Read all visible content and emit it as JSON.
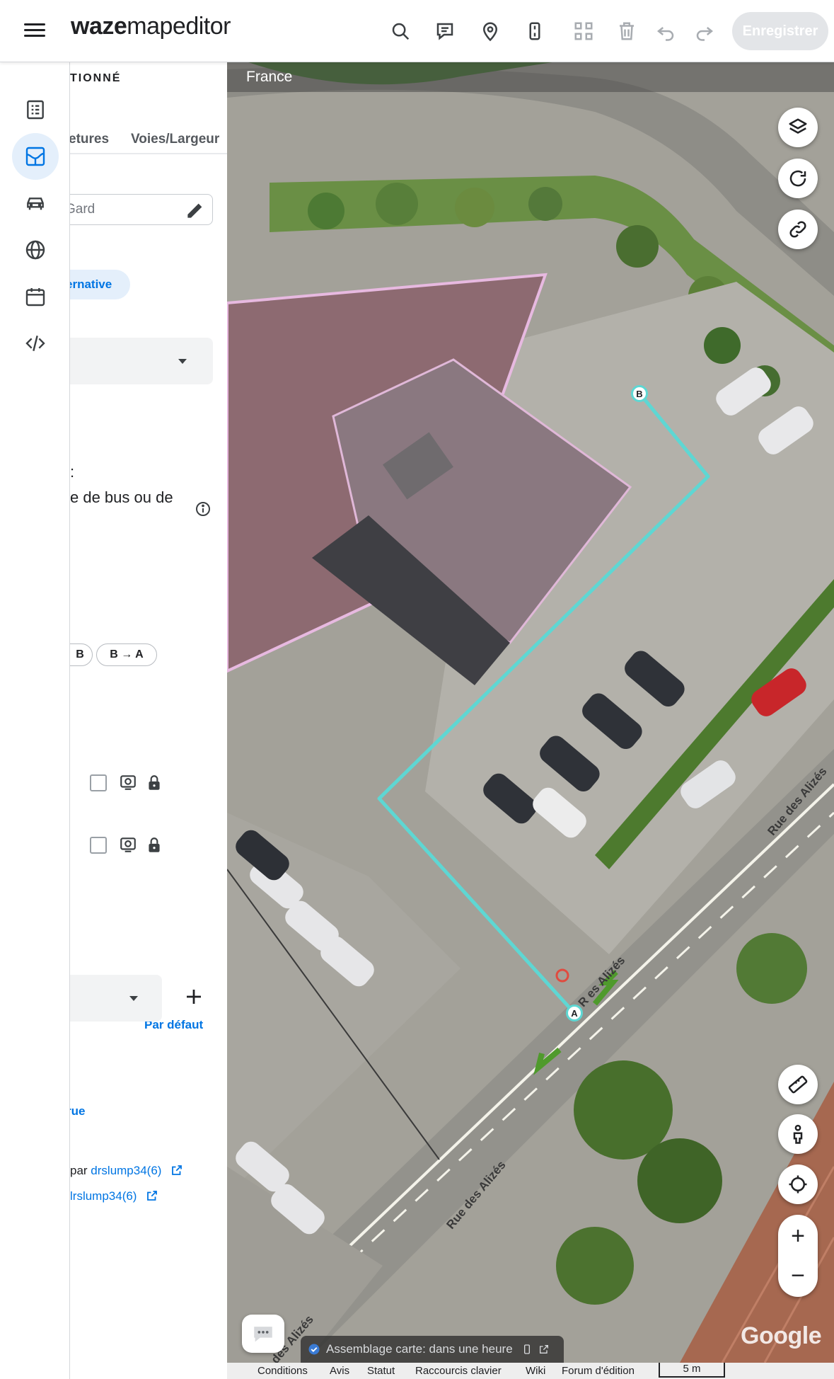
{
  "app": {
    "logo_bold": "waze",
    "logo_rest": "mapeditor",
    "save_label": "Enregistrer"
  },
  "toolbar_icons": [
    "search-icon",
    "comment-icon",
    "place-icon",
    "segment-icon",
    "select-area-icon",
    "delete-icon",
    "undo-icon",
    "redo-icon"
  ],
  "nav_rail": [
    "list-icon",
    "map-edit-icon",
    "car-icon",
    "globe-icon",
    "calendar-icon",
    "code-icon"
  ],
  "panel": {
    "title": "TIONNÉ",
    "tabs": [
      "etures",
      "Voies/Largeur"
    ],
    "name_field": "Gard",
    "alt_chip": "ernative",
    "label_k": ":",
    "label_bus": "e de bus ou de",
    "dir_chips": [
      "B",
      "B → A"
    ],
    "default_link": "Par défaut",
    "rue_link": "rue",
    "meta1_prefix": "par ",
    "meta1_user": "drslump34(6)",
    "meta2_user": "lrslump34(6)"
  },
  "map": {
    "country": "France",
    "street_name": "Rue des Alizés",
    "street_name_partial": "R   es Alizés",
    "street_name_bottom": "des Alizés",
    "node_a": "A",
    "node_b": "B",
    "build_status": "Assemblage carte: dans une heure",
    "google": "Google",
    "accent_color": "#5ed7d3"
  },
  "footer": {
    "links": [
      "Conditions",
      "Avis",
      "Statut",
      "Raccourcis clavier",
      "Wiki",
      "Forum d'édition"
    ],
    "scale": "5 m"
  }
}
